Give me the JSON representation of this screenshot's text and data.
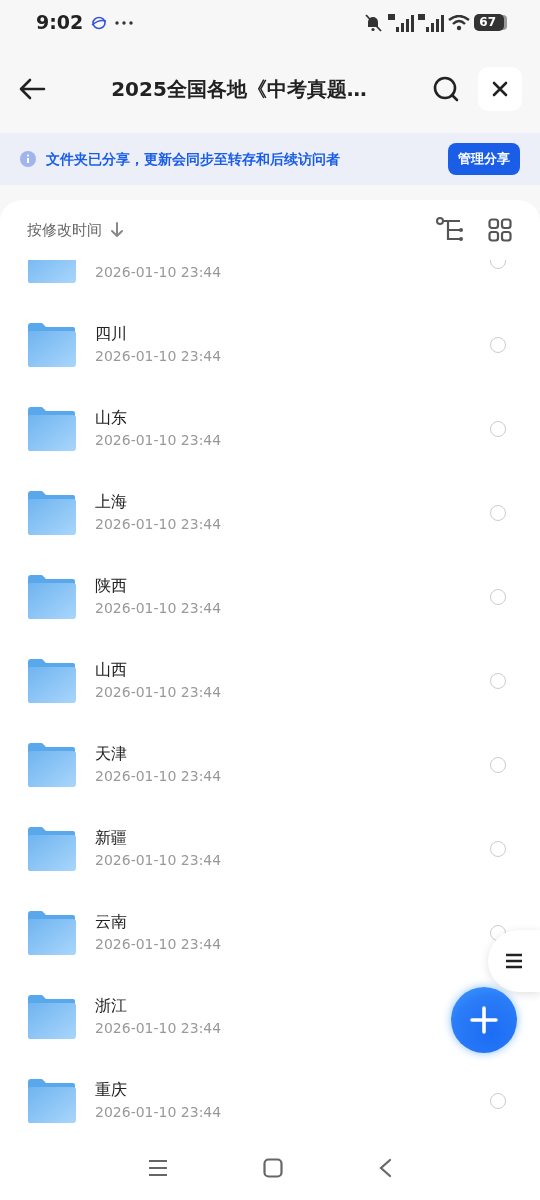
{
  "status_bar": {
    "time": "9:02",
    "battery": "67"
  },
  "header": {
    "title": "2025全国各地《中考真题…"
  },
  "banner": {
    "text": "文件夹已分享，更新会同步至转存和后续访问者",
    "button": "管理分享"
  },
  "sort": {
    "label": "按修改时间"
  },
  "files": [
    {
      "date": "2026-01-10 23:44",
      "selected": false
    },
    {
      "name": "四川",
      "date": "2026-01-10 23:44",
      "selected": false
    },
    {
      "name": "山东",
      "date": "2026-01-10 23:44",
      "selected": false
    },
    {
      "name": "上海",
      "date": "2026-01-10 23:44",
      "selected": false
    },
    {
      "name": "陕西",
      "date": "2026-01-10 23:44",
      "selected": false
    },
    {
      "name": "山西",
      "date": "2026-01-10 23:44",
      "selected": false
    },
    {
      "name": "天津",
      "date": "2026-01-10 23:44",
      "selected": false
    },
    {
      "name": "新疆",
      "date": "2026-01-10 23:44",
      "selected": false
    },
    {
      "name": "云南",
      "date": "2026-01-10 23:44",
      "selected": false
    },
    {
      "name": "浙江",
      "date": "2026-01-10 23:44"
    },
    {
      "name": "重庆",
      "date": "2026-01-10 23:44",
      "selected": false
    }
  ]
}
